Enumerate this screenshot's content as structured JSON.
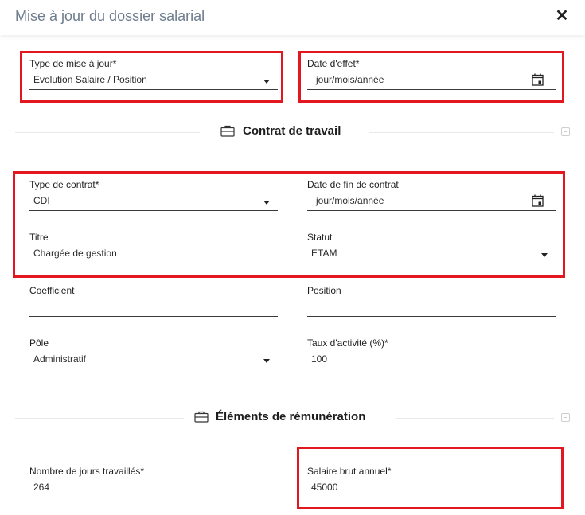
{
  "dialog": {
    "title": "Mise à jour du dossier salarial",
    "close_label": "✕"
  },
  "update": {
    "type_label": "Type de mise à jour*",
    "type_value": "Evolution Salaire / Position",
    "date_label": "Date d'effet*",
    "date_value": "jour/mois/année"
  },
  "contract": {
    "section_title": "Contrat de travail",
    "section_icon": "briefcase-icon",
    "contract_type_label": "Type de contrat*",
    "contract_type_value": "CDI",
    "end_date_label": "Date de fin de contrat",
    "end_date_value": "jour/mois/année",
    "titre_label": "Titre",
    "titre_value": "Chargée de gestion",
    "statut_label": "Statut",
    "statut_value": "ETAM",
    "coefficient_label": "Coefficient",
    "coefficient_value": "",
    "position_label": "Position",
    "position_value": "",
    "pole_label": "Pôle",
    "pole_value": "Administratif",
    "taux_label": "Taux d'activité (%)*",
    "taux_value": "100"
  },
  "remuneration": {
    "section_title": "Éléments de rémunération",
    "section_icon": "briefcase-icon",
    "jours_label": "Nombre de jours travaillés*",
    "jours_value": "264",
    "salaire_label": "Salaire brut annuel*",
    "salaire_value": "45000"
  },
  "colors": {
    "highlight": "#e3171f",
    "title": "#6e7c8c"
  }
}
